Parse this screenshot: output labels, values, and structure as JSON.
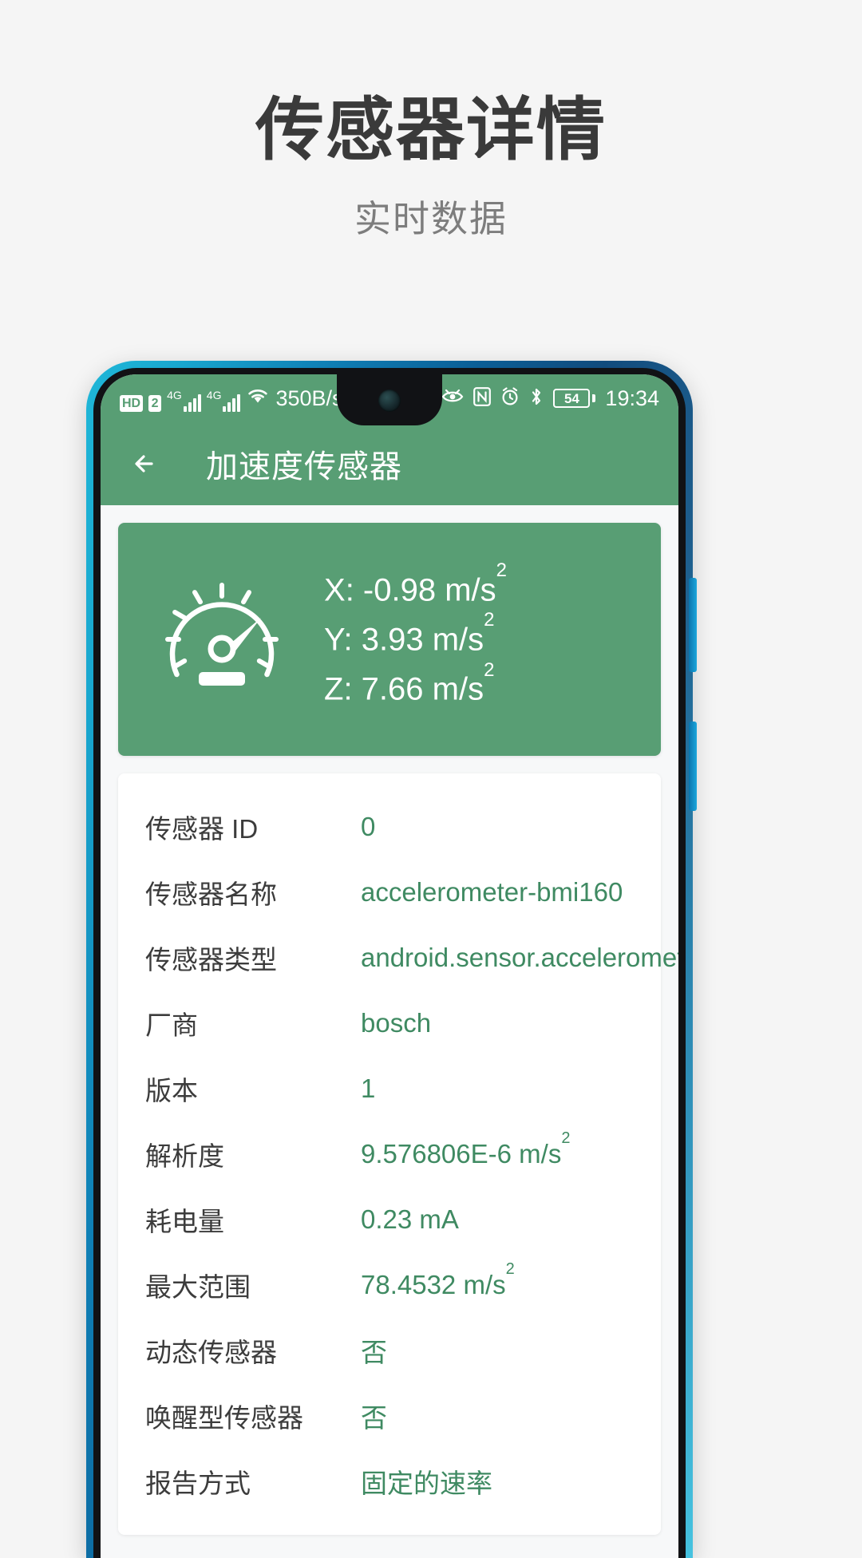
{
  "promo": {
    "title": "传感器详情",
    "subtitle": "实时数据"
  },
  "status_bar": {
    "hd_label": "HD",
    "sim_number": "2",
    "network_1": "4G",
    "network_2": "4G",
    "wifi_icon": "wifi-icon",
    "network_speed": "350B/s",
    "eye_icon": "eye-comfort-icon",
    "nfc_icon": "nfc-icon",
    "alarm_icon": "alarm-icon",
    "bluetooth_icon": "bluetooth-icon",
    "battery_percent": "54",
    "time": "19:34"
  },
  "app_bar": {
    "back_icon": "back-arrow-icon",
    "title": "加速度传感器"
  },
  "reading_card": {
    "gauge_icon": "speedometer-icon",
    "axes": [
      {
        "axis": "X",
        "value": "-0.98",
        "unit": "m/s",
        "exponent": "2"
      },
      {
        "axis": "Y",
        "value": "3.93",
        "unit": "m/s",
        "exponent": "2"
      },
      {
        "axis": "Z",
        "value": "7.66",
        "unit": "m/s",
        "exponent": "2"
      }
    ]
  },
  "info_card": {
    "rows": [
      {
        "label": "传感器 ID",
        "value": "0",
        "exponent": ""
      },
      {
        "label": "传感器名称",
        "value": "accelerometer-bmi160",
        "exponent": ""
      },
      {
        "label": "传感器类型",
        "value": "android.sensor.accelerometer",
        "exponent": ""
      },
      {
        "label": "厂商",
        "value": "bosch",
        "exponent": ""
      },
      {
        "label": "版本",
        "value": "1",
        "exponent": ""
      },
      {
        "label": "解析度",
        "value": "9.576806E-6 m/s",
        "exponent": "2"
      },
      {
        "label": "耗电量",
        "value": "0.23  mA",
        "exponent": ""
      },
      {
        "label": "最大范围",
        "value": "78.4532 m/s",
        "exponent": "2"
      },
      {
        "label": "动态传感器",
        "value": "否",
        "exponent": ""
      },
      {
        "label": "唤醒型传感器",
        "value": "否",
        "exponent": ""
      },
      {
        "label": "报告方式",
        "value": "固定的速率",
        "exponent": ""
      }
    ]
  },
  "colors": {
    "brand_green": "#589e74",
    "value_green": "#3f8a62",
    "frame_blue": "#0f7fb5",
    "page_bg": "#f5f5f5"
  }
}
